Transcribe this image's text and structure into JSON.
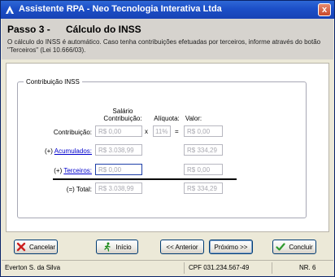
{
  "window": {
    "title": "Assistente RPA - Neo Tecnologia Interativa Ltda",
    "close_label": "x"
  },
  "header": {
    "step_number": "Passo 3 -",
    "step_title": "Cálculo do INSS",
    "description": "O cálculo do INSS é automático. Caso tenha contribuições efetuadas por terceiros, informe através do botão \"Terceiros\" (Lei 10.666/03)."
  },
  "group": {
    "label": "Contribuição INSS",
    "headers": {
      "salario": "Salário Contribuição:",
      "aliquota": "Alíquota:",
      "valor": "Valor:"
    },
    "rows": {
      "contribuicao": {
        "label": "Contribuição:",
        "salario": "R$ 0,00",
        "times": "x",
        "aliquota": "11%",
        "equals": "=",
        "valor": "R$ 0,00"
      },
      "acumulados": {
        "prefix": "(+)",
        "link": "Acumulados:",
        "salario": "R$ 3.038,99",
        "valor": "R$ 334,29"
      },
      "terceiros": {
        "prefix": "(+)",
        "link": "Terceiros:",
        "salario": "R$ 0,00",
        "valor": "R$ 0,00"
      },
      "total": {
        "label": "(=) Total:",
        "salario": "R$ 3.038,99",
        "valor": "R$ 334,29"
      }
    }
  },
  "buttons": {
    "cancelar": "Cancelar",
    "inicio": "Início",
    "anterior": "<< Anterior",
    "proximo": "Próximo >>",
    "concluir": "Concluir"
  },
  "status": {
    "user": "Everton S. da Silva",
    "cpf": "CPF 031.234.567-49",
    "nr": "NR. 6"
  },
  "colors": {
    "title_bar": "#1c4fc7",
    "header_bg": "#d6d3ce",
    "link": "#0000cc",
    "cancel_icon": "#cc1f1f",
    "check_icon": "#2e9a2e"
  },
  "icons": {
    "app": "neo-logo-icon",
    "cancel": "red-x-icon",
    "home": "running-man-icon",
    "finish": "green-check-icon"
  }
}
